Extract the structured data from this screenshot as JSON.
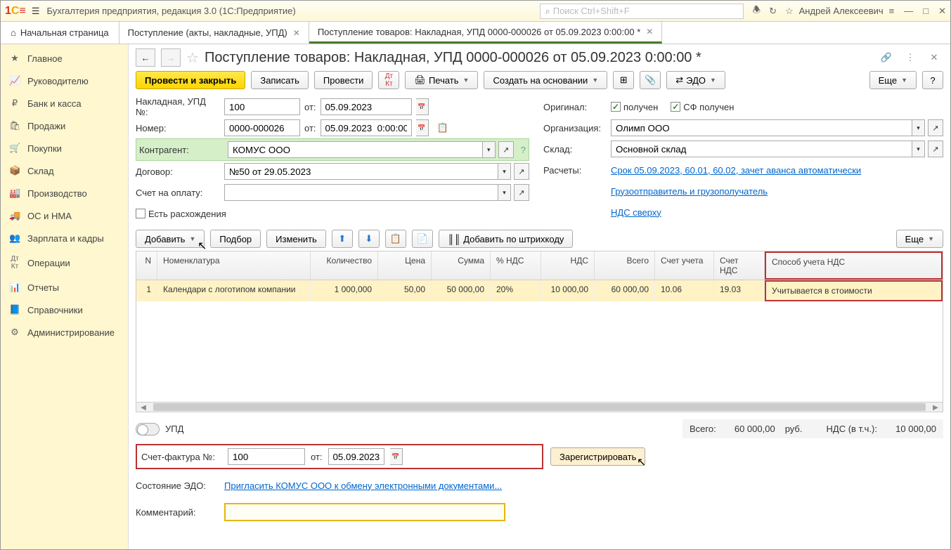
{
  "app": {
    "title": "Бухгалтерия предприятия, редакция 3.0  (1С:Предприятие)",
    "search_placeholder": "Поиск Ctrl+Shift+F",
    "user": "Андрей Алексеевич"
  },
  "tabs": {
    "home": "Начальная страница",
    "t1": "Поступление (акты, накладные, УПД)",
    "t2": "Поступление товаров: Накладная, УПД 0000-000026 от 05.09.2023 0:00:00 *"
  },
  "sidebar": [
    "Главное",
    "Руководителю",
    "Банк и касса",
    "Продажи",
    "Покупки",
    "Склад",
    "Производство",
    "ОС и НМА",
    "Зарплата и кадры",
    "Операции",
    "Отчеты",
    "Справочники",
    "Администрирование"
  ],
  "doc": {
    "title": "Поступление товаров: Накладная, УПД 0000-000026 от 05.09.2023 0:00:00 *"
  },
  "toolbar": {
    "post_close": "Провести и закрыть",
    "save": "Записать",
    "post": "Провести",
    "print": "Печать",
    "create_based": "Создать на основании",
    "edo": "ЭДО",
    "more": "Еще"
  },
  "form": {
    "invoice_lbl": "Накладная, УПД №:",
    "invoice_no": "100",
    "from": "от:",
    "invoice_date": "05.09.2023",
    "number_lbl": "Номер:",
    "number": "0000-000026",
    "number_date": "05.09.2023  0:00:00",
    "contragent_lbl": "Контрагент:",
    "contragent": "КОМУС ООО",
    "contract_lbl": "Договор:",
    "contract": "№50 от 29.05.2023",
    "bill_lbl": "Счет на оплату:",
    "diff_lbl": "Есть расхождения",
    "original_lbl": "Оригинал:",
    "received": "получен",
    "sf_received": "СФ получен",
    "org_lbl": "Организация:",
    "org": "Олимп ООО",
    "warehouse_lbl": "Склад:",
    "warehouse": "Основной склад",
    "calc_lbl": "Расчеты:",
    "calc_link": "Срок 05.09.2023, 60.01, 60.02, зачет аванса автоматически",
    "shipper_link": "Грузоотправитель и грузополучатель",
    "vat_link": "НДС сверху"
  },
  "tblbar": {
    "add": "Добавить",
    "pick": "Подбор",
    "edit": "Изменить",
    "barcode": "Добавить по штрихкоду",
    "more": "Еще"
  },
  "table": {
    "headers": {
      "n": "N",
      "nom": "Номенклатура",
      "qty": "Количество",
      "price": "Цена",
      "sum": "Сумма",
      "vatp": "% НДС",
      "vat": "НДС",
      "total": "Всего",
      "acc": "Счет учета",
      "vatacc": "Счет НДС",
      "vatmode": "Способ учета НДС"
    },
    "row": {
      "n": "1",
      "nom": "Календари с логотипом компании",
      "qty": "1 000,000",
      "price": "50,00",
      "sum": "50 000,00",
      "vatp": "20%",
      "vat": "10 000,00",
      "total": "60 000,00",
      "acc": "10.06",
      "vatacc": "19.03",
      "vatmode": "Учитывается в стоимости"
    }
  },
  "footer": {
    "upd": "УПД",
    "totals_lbl": "Всего:",
    "totals_val": "60 000,00",
    "rub": "руб.",
    "vat_lbl": "НДС (в т.ч.):",
    "vat_val": "10 000,00",
    "sf_lbl": "Счет-фактура №:",
    "sf_no": "100",
    "sf_date": "05.09.2023",
    "register": "Зарегистрировать",
    "edo_state_lbl": "Состояние ЭДО:",
    "edo_state_link": "Пригласить КОМУС ООО к обмену электронными документами...",
    "comment_lbl": "Комментарий:"
  }
}
